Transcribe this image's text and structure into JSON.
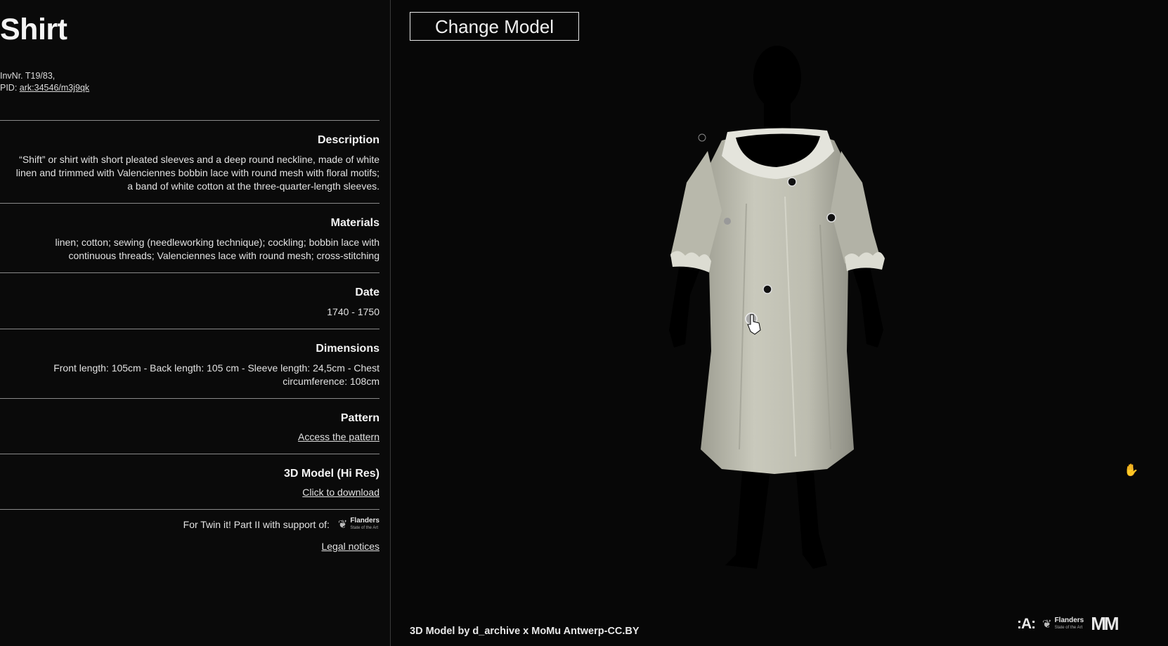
{
  "object": {
    "title": "Shirt",
    "inv_label": "InvNr. T19/83,",
    "pid_label": "PID:",
    "pid_link": "ark:34546/m3j9qk"
  },
  "sections": {
    "description": {
      "heading": "Description",
      "text": "“Shift” or shirt with short pleated sleeves and a deep round neckline, made of white linen and trimmed with Valenciennes bobbin lace with round mesh with floral motifs; a band of white cotton at the three-quarter-length sleeves."
    },
    "materials": {
      "heading": "Materials",
      "text": "linen; cotton; sewing (needleworking technique); cockling; bobbin lace with continuous threads; Valenciennes lace with round mesh; cross-stitching"
    },
    "date": {
      "heading": "Date",
      "text": "1740 - 1750"
    },
    "dimensions": {
      "heading": "Dimensions",
      "text": "Front length: 105cm - Back length: 105 cm - Sleeve length: 24,5cm - Chest circumference: 108cm"
    },
    "pattern": {
      "heading": "Pattern",
      "link": "Access the pattern"
    },
    "model3d": {
      "heading": "3D Model (Hi Res)",
      "link": "Click to download"
    }
  },
  "support": {
    "text": "For Twin it! Part II with support of:",
    "flanders_name": "Flanders",
    "flanders_tagline": "State of the Art",
    "legal_link": "Legal notices"
  },
  "viewer": {
    "change_model_label": "Change Model",
    "credit": "3D Model by d_archive x MoMu Antwerp-CC.BY",
    "footer_flanders_name": "Flanders",
    "footer_flanders_tagline": "State of the Art",
    "antwerp_logo_text": ":A:",
    "momu_logo_text": "MM",
    "icons": [
      "hand-cursor-icon",
      "grab-hand-icon",
      "hotspot-icon",
      "flanders-lion-icon"
    ]
  },
  "colors": {
    "background": "#070707",
    "panel": "#0a0a0a",
    "text": "#e8e8e8",
    "fabric": "#c4c4b6",
    "divider": "#8a8a8a"
  }
}
